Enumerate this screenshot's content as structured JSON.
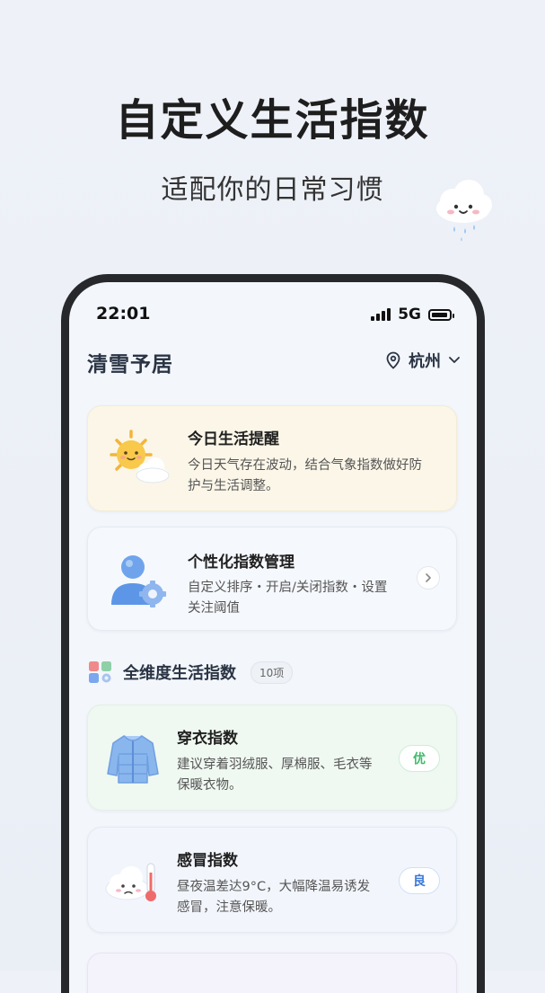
{
  "promo": {
    "title": "自定义生活指数",
    "subtitle": "适配你的日常习惯"
  },
  "status_bar": {
    "time": "22:01",
    "network": "5G"
  },
  "header": {
    "app_name": "清雪予居",
    "city": "杭州"
  },
  "reminder_card": {
    "title": "今日生活提醒",
    "line1": "今日天气存在波动，结合气象指数做好防",
    "line2": "护与生活调整。"
  },
  "manage_card": {
    "title": "个性化指数管理",
    "line1": "自定义排序・开启/关闭指数・设置",
    "line2": "关注阈值"
  },
  "section": {
    "title": "全维度生活指数",
    "count": "10项"
  },
  "indices": [
    {
      "title": "穿衣指数",
      "line1": "建议穿着羽绒服、厚棉服、毛衣等",
      "line2": "保暖衣物。",
      "level": "优"
    },
    {
      "title": "感冒指数",
      "line1": "昼夜温差达9°C，大幅降温易诱发",
      "line2": "感冒，注意保暖。",
      "level": "良"
    }
  ],
  "colors": {
    "level_good": "#3dba6a",
    "level_fair": "#3a78d8",
    "reminder_bg": "#fbf6e8",
    "clothing_bg": "#eff8f1"
  }
}
